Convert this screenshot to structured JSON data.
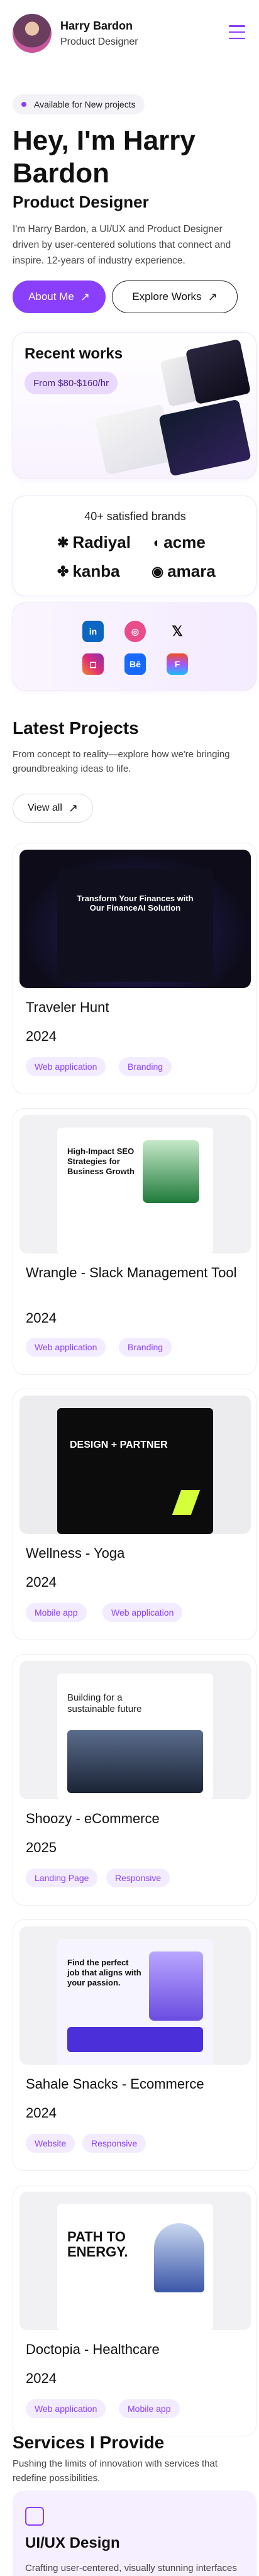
{
  "header": {
    "name": "Harry Bardon",
    "role": "Product Designer"
  },
  "hero": {
    "badge": "Available for New projects",
    "title": "Hey, I'm Harry Bardon",
    "subtitle": "Product Designer",
    "description": "I'm Harry Bardon, a UI/UX and Product Designer driven by user-centered solutions that connect and inspire. 12-years of industry experience.",
    "primary_cta": "About Me",
    "secondary_cta": "Explore Works"
  },
  "recent_works": {
    "title": "Recent works",
    "price": "From $80-$160/hr"
  },
  "brands": {
    "title": "40+ satisfied brands",
    "items": [
      "Radiyal",
      "acme",
      "kanba",
      "amara"
    ]
  },
  "socials": [
    "linkedin-icon",
    "dribbble-icon",
    "x-icon",
    "instagram-icon",
    "behance-icon",
    "figma-icon"
  ],
  "projects_section": {
    "title": "Latest Projects",
    "description": "From concept to reality—explore how we're bringing groundbreaking ideas to life.",
    "view_all": "View all"
  },
  "projects": [
    {
      "title": "Traveler Hunt",
      "year": "2024",
      "tags": [
        "Web application",
        "Branding"
      ],
      "thumb_headline": "Transform Your Finances with Our FinanceAI Solution"
    },
    {
      "title": "Wrangle - Slack Management Tool",
      "year": "2024",
      "tags": [
        "Web application",
        "Branding"
      ],
      "thumb_headline": "High-Impact SEO Strategies for Business Growth"
    },
    {
      "title": "Wellness - Yoga",
      "year": "2024",
      "tags": [
        "Mobile app",
        "Web application"
      ],
      "thumb_headline": "DESIGN + PARTNER"
    },
    {
      "title": "Shoozy - eCommerce",
      "year": "2025",
      "tags": [
        "Landing Page",
        "Responsive"
      ],
      "thumb_headline": "Building for a sustainable future"
    },
    {
      "title": "Sahale Snacks - Ecommerce",
      "year": "2024",
      "tags": [
        "Website",
        "Responsive"
      ],
      "thumb_headline": "Find the perfect job that aligns with your passion."
    },
    {
      "title": "Doctopia - Healthcare",
      "year": "2024",
      "tags": [
        "Web application",
        "Mobile app"
      ],
      "thumb_headline": "PATH TO ENERGY."
    }
  ],
  "services": {
    "title": "Services I Provide",
    "description": "Pushing the limits of innovation with services that redefine possibilities.",
    "card_title": "UI/UX Design",
    "card_desc": "Crafting user-centered, visually stunning interfaces that resonate."
  },
  "colors": {
    "accent": "#8a3ffc",
    "tag_bg": "#f3ebff"
  }
}
